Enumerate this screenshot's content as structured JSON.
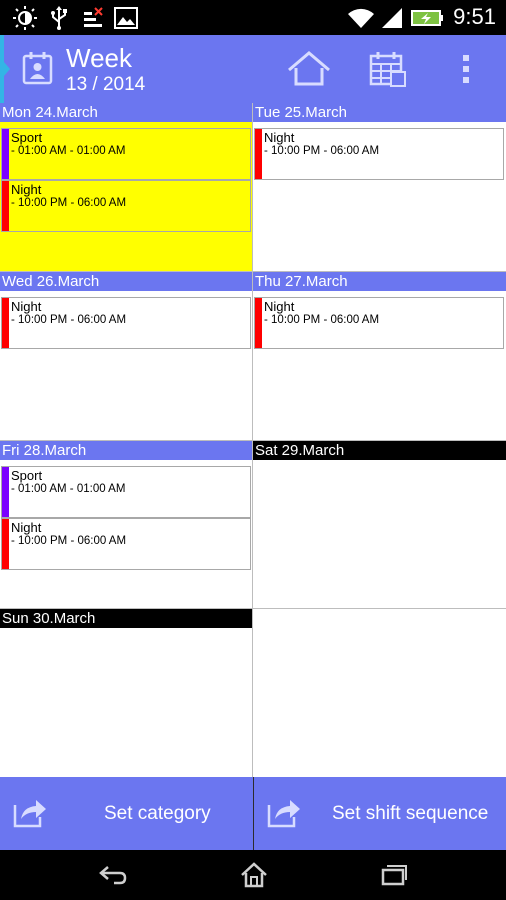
{
  "status_bar": {
    "time": "9:51",
    "icons": [
      "brightness-icon",
      "usb-icon",
      "signal-off-icon",
      "image-icon",
      "wifi-icon",
      "cell-signal-icon",
      "battery-charging-icon"
    ]
  },
  "action_bar": {
    "title": "Week",
    "subtitle": "13 / 2014",
    "icons": [
      "calendar-person-icon",
      "home-icon",
      "calendar-grid-icon",
      "overflow-menu-icon"
    ]
  },
  "days": [
    {
      "label": "Mon 24.March",
      "header_color": "#6b76f0",
      "background": "#ffff00",
      "events": [
        {
          "name": "Sport",
          "time": "- 01:00 AM - 01:00 AM",
          "color": "#7b00ff",
          "background": "#ffff00"
        },
        {
          "name": "Night",
          "time": "- 10:00 PM - 06:00 AM",
          "color": "#ff0000",
          "background": "#ffff00"
        }
      ]
    },
    {
      "label": "Tue 25.March",
      "header_color": "#6b76f0",
      "background": "#ffffff",
      "events": [
        {
          "name": "Night",
          "time": "- 10:00 PM - 06:00 AM",
          "color": "#ff0000",
          "background": "#ffffff"
        }
      ]
    },
    {
      "label": "Wed 26.March",
      "header_color": "#6b76f0",
      "background": "#ffffff",
      "events": [
        {
          "name": "Night",
          "time": "- 10:00 PM - 06:00 AM",
          "color": "#ff0000",
          "background": "#ffffff"
        }
      ]
    },
    {
      "label": "Thu 27.March",
      "header_color": "#6b76f0",
      "background": "#ffffff",
      "events": [
        {
          "name": "Night",
          "time": "- 10:00 PM - 06:00 AM",
          "color": "#ff0000",
          "background": "#ffffff"
        }
      ]
    },
    {
      "label": "Fri 28.March",
      "header_color": "#6b76f0",
      "background": "#ffffff",
      "events": [
        {
          "name": "Sport",
          "time": "- 01:00 AM - 01:00 AM",
          "color": "#7b00ff",
          "background": "#ffffff"
        },
        {
          "name": "Night",
          "time": "- 10:00 PM - 06:00 AM",
          "color": "#ff0000",
          "background": "#ffffff"
        }
      ]
    },
    {
      "label": "Sat 29.March",
      "header_color": "#000000",
      "background": "#ffffff",
      "events": []
    },
    {
      "label": "Sun 30.March",
      "header_color": "#000000",
      "background": "#ffffff",
      "events": []
    }
  ],
  "bottom_bar": {
    "set_category_label": "Set category",
    "set_shift_sequence_label": "Set shift sequence",
    "icons": [
      "share-edit-icon",
      "share-edit-icon"
    ]
  },
  "nav_bar": {
    "icons": [
      "back-icon",
      "home-icon",
      "recent-apps-icon"
    ]
  },
  "colors": {
    "accent": "#6b76f0",
    "highlight": "#ffff00",
    "sport": "#7b00ff",
    "night": "#ff0000"
  }
}
